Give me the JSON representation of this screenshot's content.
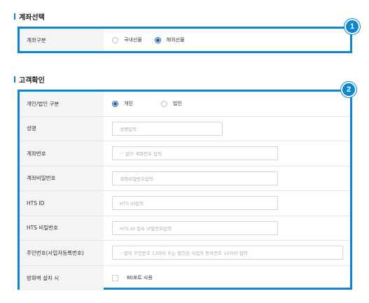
{
  "account_section": {
    "title": "계좌선택",
    "badge": "1",
    "row_label": "계좌구분",
    "options": [
      {
        "label": "국내선물",
        "selected": false
      },
      {
        "label": "해외선물",
        "selected": true
      }
    ]
  },
  "customer_section": {
    "title": "고객확인",
    "badge": "2",
    "type_label": "개인/법인 구분",
    "type_options": [
      {
        "label": "개인",
        "selected": true
      },
      {
        "label": "법인",
        "selected": false
      }
    ],
    "name_label": "성명",
    "name_placeholder": "성명입력",
    "account_no_label": "계좌번호",
    "account_no_placeholder": "'-' 없이 계좌번호 입력",
    "account_pw_label": "계좌비밀번호",
    "account_pw_placeholder": "계좌비밀번호입력",
    "hts_id_label": "HTS ID",
    "hts_id_placeholder": "HTS ID입력",
    "hts_pw_label": "HTS 비밀번호",
    "hts_pw_placeholder": "HTS ID 접속 비밀번호입력",
    "resident_label": "주민번호(사업자등록번호)",
    "resident_placeholder": "'-'없이 주민번호 13자리 또는 법인은 사업자 등록번호 10자리 입력",
    "firewall_label": "방화벽 설치 시",
    "firewall_checkbox_label": "80포트 사용"
  }
}
